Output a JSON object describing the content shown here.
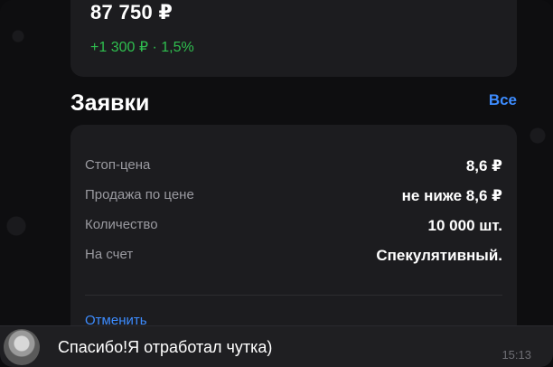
{
  "portfolio": {
    "value": "87 750 ₽",
    "change": "+1 300 ₽ · 1,5%"
  },
  "orders": {
    "title": "Заявки",
    "all_link": "Все",
    "rows": [
      {
        "label": "Стоп-цена",
        "value": "8,6 ₽"
      },
      {
        "label": "Продажа по цене",
        "value": "не ниже 8,6 ₽"
      },
      {
        "label": "Количество",
        "value": "10 000 шт."
      },
      {
        "label": "На счет",
        "value": "Спекулятивный."
      }
    ],
    "cancel_label": "Отменить"
  },
  "chat": {
    "message": "Спасибо!Я отработал чутка)",
    "time": "15:13"
  },
  "colors": {
    "accent": "#3d8cff",
    "positive": "#2fbf4f"
  }
}
